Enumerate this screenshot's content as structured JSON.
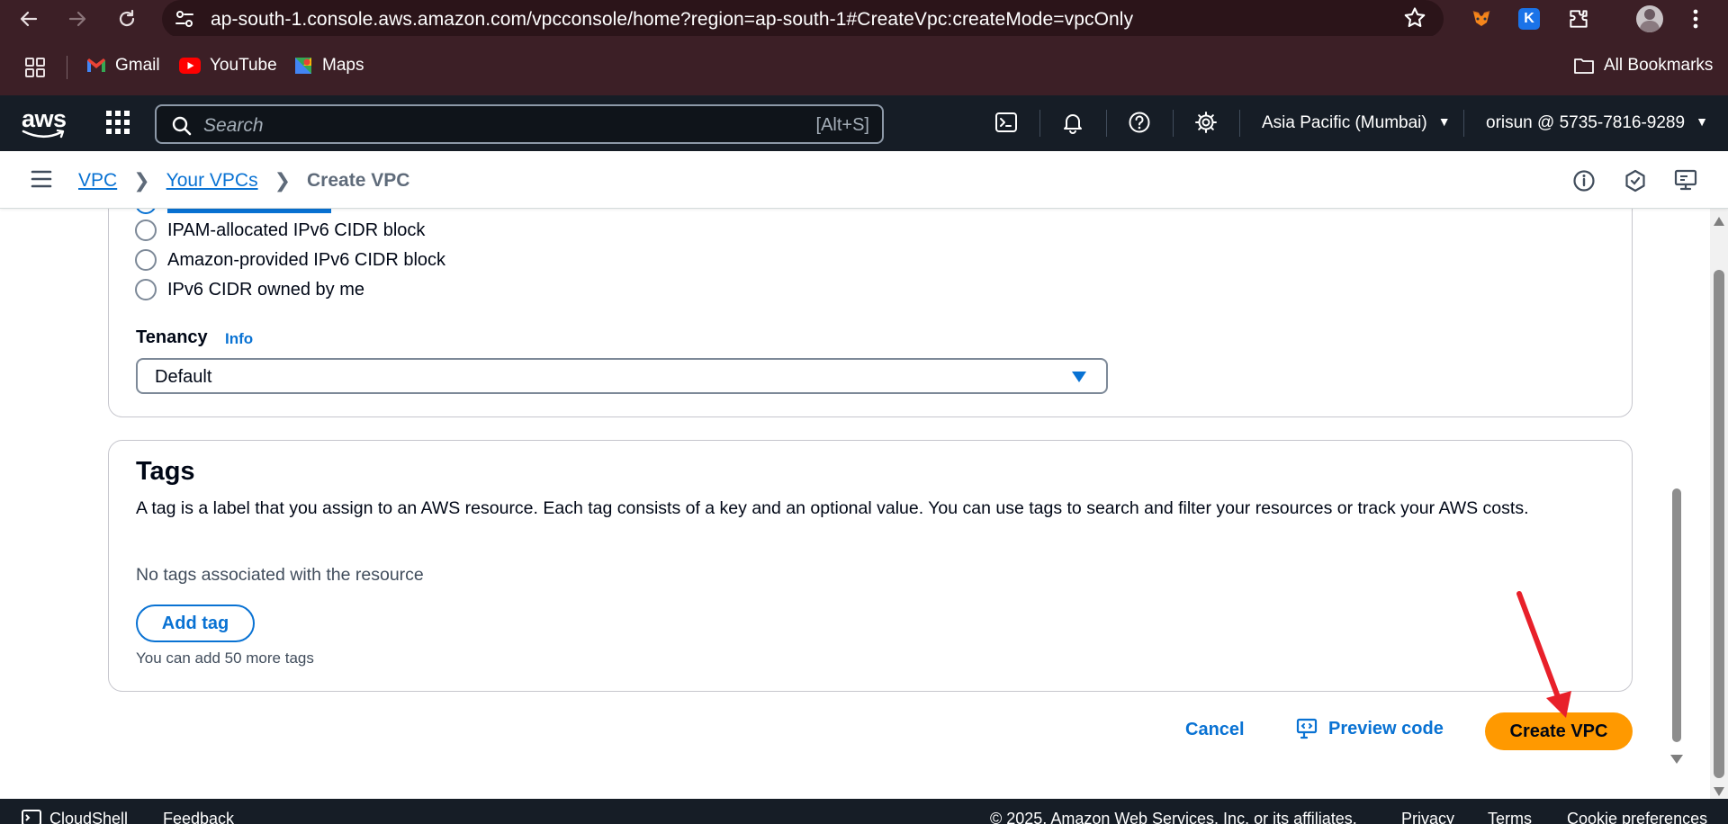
{
  "browser": {
    "url": "ap-south-1.console.aws.amazon.com/vpcconsole/home?region=ap-south-1#CreateVpc:createMode=vpcOnly",
    "bookmarks": [
      "Gmail",
      "YouTube",
      "Maps"
    ],
    "all_bookmarks": "All Bookmarks",
    "ext_k_letter": "K"
  },
  "aws_nav": {
    "logo": "aws",
    "search_placeholder": "Search",
    "search_shortcut": "[Alt+S]",
    "region": "Asia Pacific (Mumbai)",
    "account": "orisun @ 5735-7816-9289"
  },
  "breadcrumb": {
    "items": [
      "VPC",
      "Your VPCs"
    ],
    "current": "Create VPC"
  },
  "ipv6": {
    "options": [
      "IPAM-allocated IPv6 CIDR block",
      "Amazon-provided IPv6 CIDR block",
      "IPv6 CIDR owned by me"
    ]
  },
  "tenancy": {
    "label": "Tenancy",
    "info": "Info",
    "value": "Default"
  },
  "tags": {
    "heading": "Tags",
    "description": "A tag is a label that you assign to an AWS resource. Each tag consists of a key and an optional value. You can use tags to search and filter your resources or track your AWS costs.",
    "empty": "No tags associated with the resource",
    "add_button": "Add tag",
    "remaining": "You can add 50 more tags"
  },
  "actions": {
    "cancel": "Cancel",
    "preview": "Preview code",
    "create": "Create VPC"
  },
  "footer": {
    "cloudshell": "CloudShell",
    "feedback": "Feedback",
    "copyright": "© 2025, Amazon Web Services, Inc. or its affiliates.",
    "privacy": "Privacy",
    "terms": "Terms",
    "cookies": "Cookie preferences"
  },
  "colors": {
    "link": "#0972d3",
    "primary_button": "#ff9900",
    "nav_bg": "#161d26",
    "browser_bg": "#3c1f26",
    "annotation_arrow": "#e8202a"
  }
}
